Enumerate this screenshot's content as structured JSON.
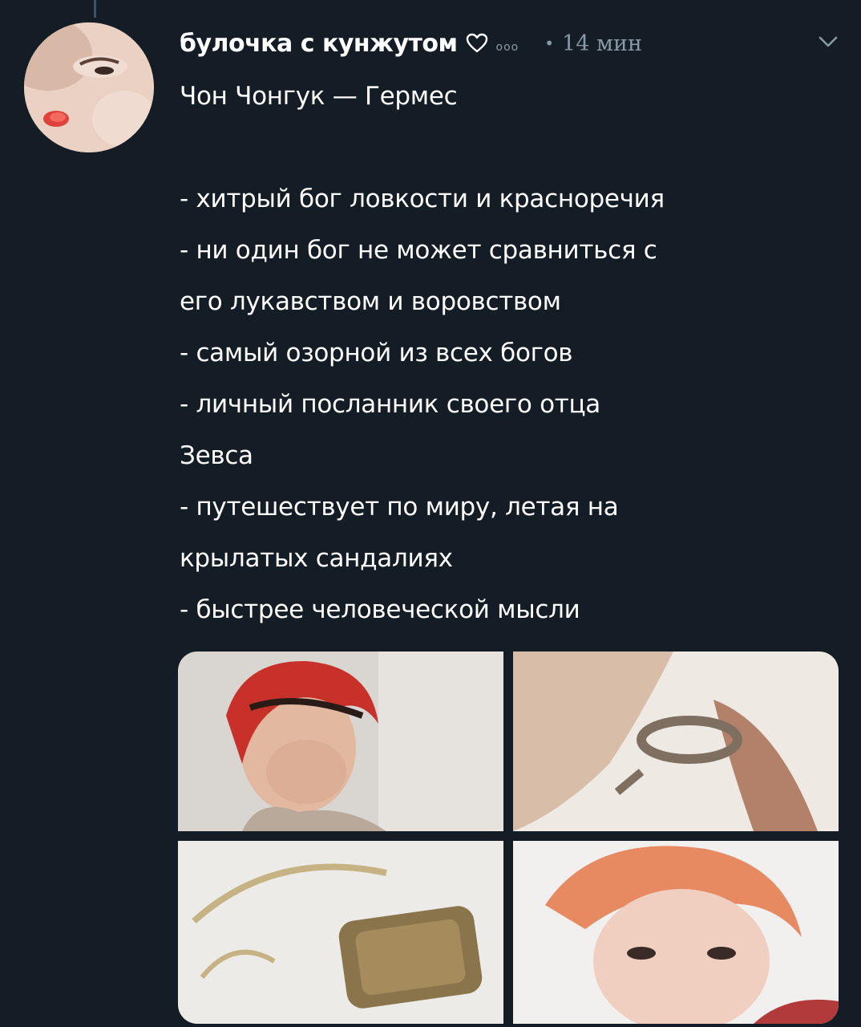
{
  "tweet": {
    "display_name": "булочка с кунжутом",
    "heart_glyph": "♡",
    "extra_glyph": "ooo",
    "separator": "•",
    "timestamp": "14 мин",
    "lines": [
      "Чон Чонгук — Гермес",
      "",
      "- хитрый бог ловкости и красноречия",
      "- ни один бог не может сравниться с",
      "его лукавством и воровством",
      "- самый озорной из всех богов",
      "- личный посланник своего отца",
      "Зевса",
      "- путешествует по миру, летая на",
      "крылатых сандалиях",
      "- быстрее человеческой мысли"
    ]
  },
  "icons": {
    "heart": "heart-icon",
    "menu": "chevron-down-icon"
  },
  "colors": {
    "background": "#141d26",
    "text": "#ffffff",
    "secondary": "#8899a6"
  }
}
